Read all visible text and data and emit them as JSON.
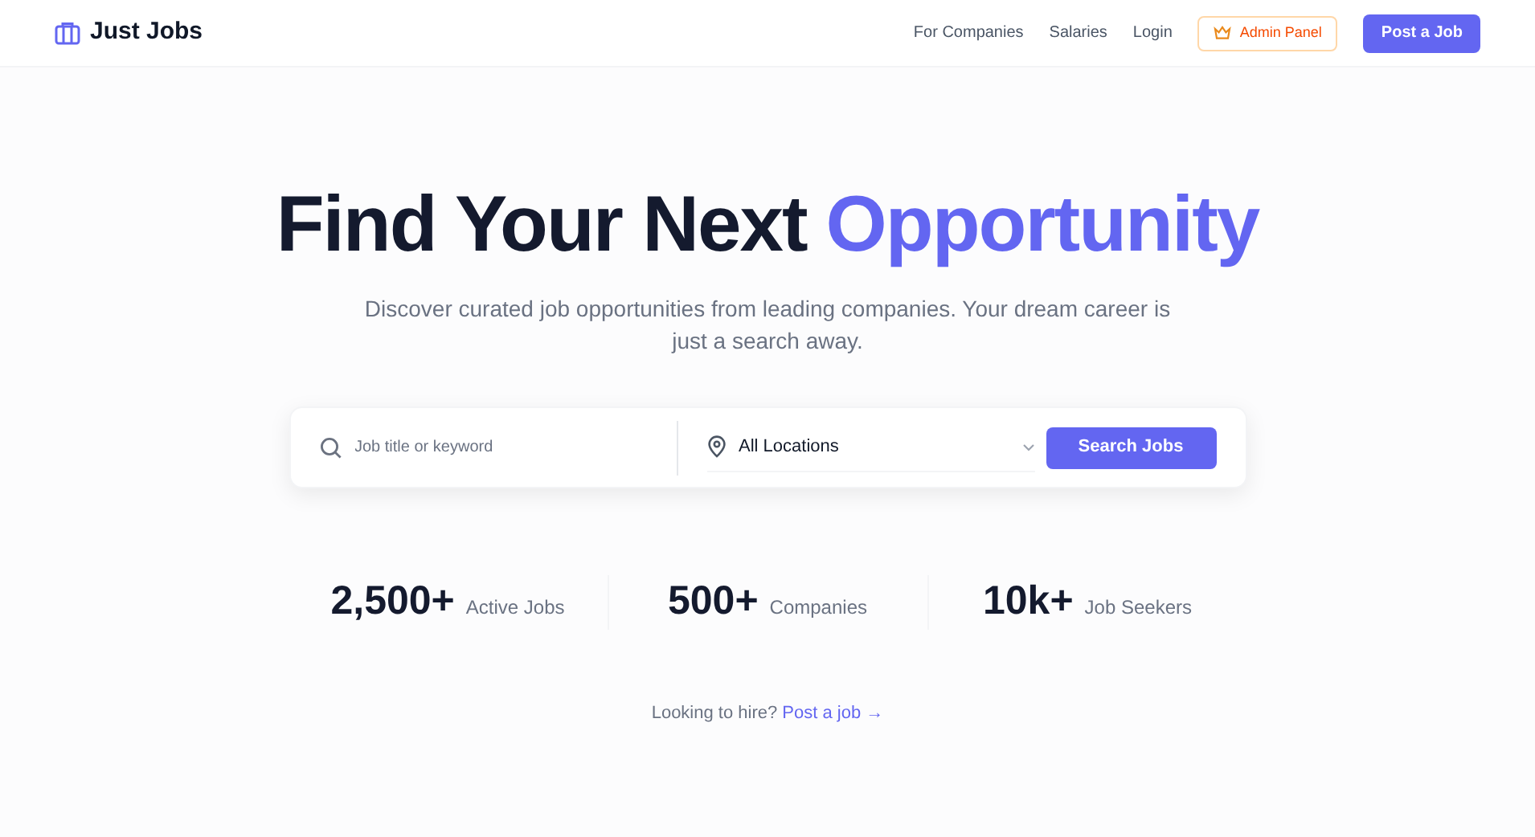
{
  "header": {
    "brand": "Just Jobs",
    "nav": [
      "For Companies",
      "Salaries",
      "Login"
    ],
    "admin_button": "Admin Panel",
    "post_button": "Post a Job"
  },
  "hero": {
    "title": "Find Your Next",
    "title_highlight": "Opportunity",
    "subtitle": "Discover curated job opportunities from leading companies. Your dream career is just a search away."
  },
  "search": {
    "placeholder": "Job title or keyword",
    "location": "All Locations",
    "button": "Search Jobs"
  },
  "stats": [
    {
      "value": "2,500+",
      "label": "Active Jobs"
    },
    {
      "value": "500+",
      "label": "Companies"
    },
    {
      "value": "10k+",
      "label": "Job Seekers"
    }
  ],
  "hire": {
    "text": "Looking to hire?",
    "link": "Post a job →"
  }
}
